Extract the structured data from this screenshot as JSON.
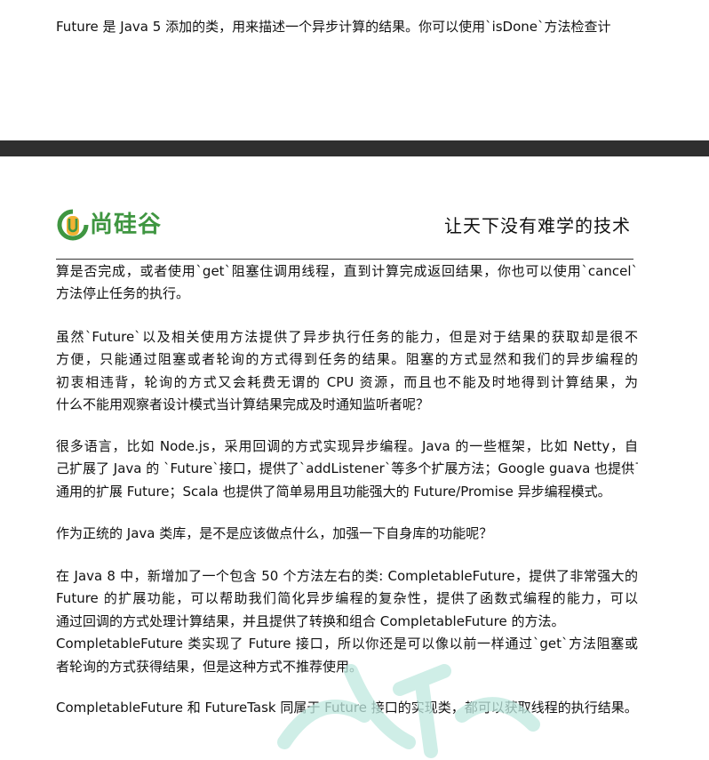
{
  "previous_page": {
    "lines": [
      "Future 是 Java 5 添加的类，用来描述一个异步计算的结果。你可以使用`isDone`方法检查计"
    ]
  },
  "header": {
    "logo_text": "尚硅谷",
    "slogan": "让天下没有难学的技术"
  },
  "paragraphs": [
    {
      "lines": [
        "算是否完成，或者使用`get`阻塞住调用线程，直到计算完成返回结果，你也可以使用`cancel`",
        "方法停止任务的执行。"
      ]
    },
    {
      "lines": [
        "虽然`Future`以及相关使用方法提供了异步执行任务的能力，但是对于结果的获取却是很不",
        "方便，只能通过阻塞或者轮询的方式得到任务的结果。阻塞的方式显然和我们的异步编程的",
        "初衷相违背，轮询的方式又会耗费无谓的 CPU 资源，而且也不能及时地得到计算结果，为",
        "什么不能用观察者设计模式当计算结果完成及时通知监听者呢？"
      ]
    },
    {
      "lines": [
        "很多语言，比如 Node.js，采用回调的方式实现异步编程。Java 的一些框架，比如 Netty，自",
        "己扩展了 Java 的 `Future`接口，提供了`addListener`等多个扩展方法；Google guava 也提供了",
        "通用的扩展 Future；Scala 也提供了简单易用且功能强大的 Future/Promise 异步编程模式。"
      ]
    },
    {
      "lines": [
        "作为正统的 Java 类库，是不是应该做点什么，加强一下自身库的功能呢？"
      ]
    },
    {
      "lines": [
        "在 Java 8 中，新增加了一个包含 50 个方法左右的类: CompletableFuture，提供了非常强大的",
        "Future 的扩展功能，可以帮助我们简化异步编程的复杂性，提供了函数式编程的能力，可以",
        "通过回调的方式处理计算结果，并且提供了转换和组合 CompletableFuture 的方法。",
        "CompletableFuture 类实现了 Future 接口，所以你还是可以像以前一样通过`get`方法阻塞或",
        "者轮询的方式获得结果，但是这种方式不推荐使用。"
      ]
    },
    {
      "lines": [
        "CompletableFuture 和 FutureTask 同属于 Future 接口的实现类，都可以获取线程的执行结果。"
      ]
    }
  ],
  "colors": {
    "logo_green": "#3f9641",
    "divider": "#2f2f2f",
    "watermark": "#bfe9e0"
  }
}
